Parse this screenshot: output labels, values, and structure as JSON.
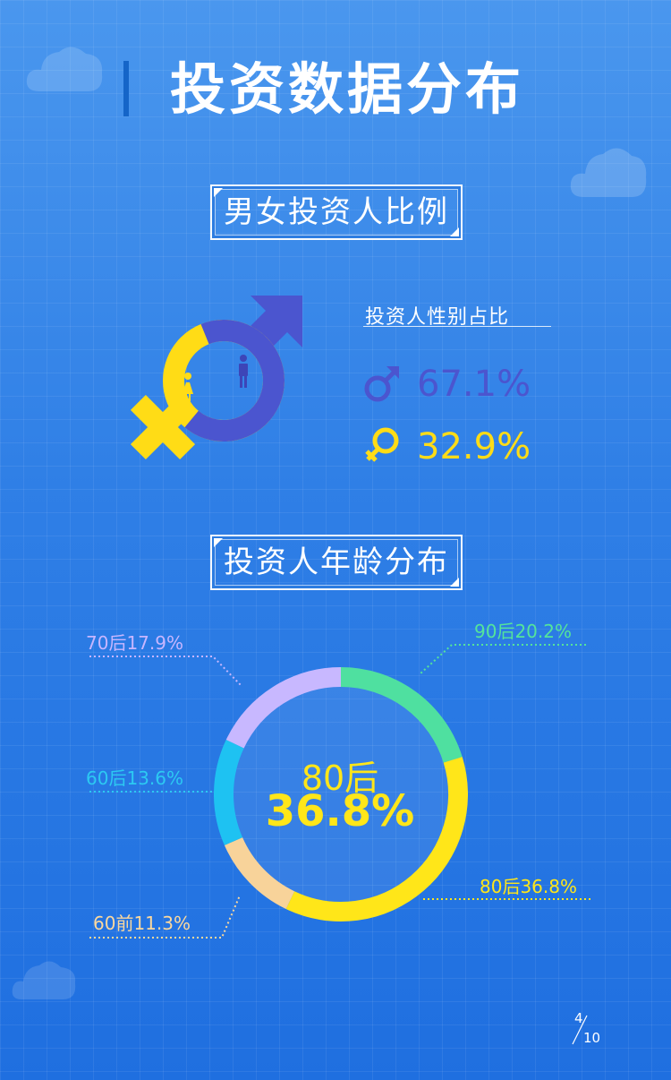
{
  "header": {
    "title": "投资数据分布"
  },
  "sections": {
    "gender_title": "男女投资人比例",
    "age_title": "投资人年龄分布"
  },
  "gender": {
    "label": "投资人性别占比",
    "male": {
      "icon": "male-symbol-icon",
      "value": "67.1%",
      "color": "#4b55cf"
    },
    "female": {
      "icon": "female-symbol-icon",
      "value": "32.9%",
      "color": "#ffdc16"
    }
  },
  "age": {
    "center": {
      "label": "80后",
      "value": "36.8%"
    },
    "labels": {
      "post70": "70后17.9%",
      "post90": "90后20.2%",
      "post60": "60后13.6%",
      "post80": "80后36.8%",
      "pre60": "60前11.3%"
    }
  },
  "chart_data": [
    {
      "type": "pie",
      "title": "投资人性别占比",
      "categories": [
        "男",
        "女"
      ],
      "values": [
        67.1,
        32.9
      ],
      "colors": [
        "#4b55cf",
        "#ffdc16"
      ]
    },
    {
      "type": "pie",
      "title": "投资人年龄分布",
      "categories": [
        "90后",
        "80后",
        "60前",
        "60后",
        "70后"
      ],
      "values": [
        20.2,
        36.8,
        11.3,
        13.6,
        17.9
      ],
      "colors": [
        "#4fe0a0",
        "#ffe619",
        "#f8d39a",
        "#1ec2f2",
        "#c8b8ff"
      ],
      "legend": "callout-labels"
    }
  ],
  "pagination": {
    "current": "4",
    "total": "10"
  }
}
